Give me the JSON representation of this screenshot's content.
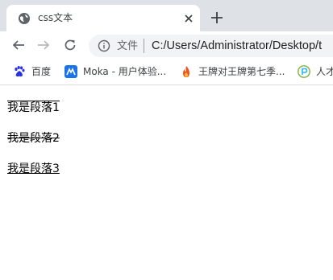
{
  "browser": {
    "tab_title": "css文本",
    "url_scheme_label": "文件",
    "url": "C:/Users/Administrator/Desktop/t"
  },
  "bookmarks": [
    {
      "label": "百度",
      "icon": "baidu-paw-icon"
    },
    {
      "label": "Moka - 用户体验...",
      "icon": "moka-icon"
    },
    {
      "label": "王牌对王牌第七季...",
      "icon": "flame-icon"
    },
    {
      "label": "人才",
      "icon": "green-p-icon"
    }
  ],
  "page": {
    "paragraphs": [
      {
        "text": "我是段落1",
        "decoration": "overline"
      },
      {
        "text": "我是段落2",
        "decoration": "line-through"
      },
      {
        "text": "我是段落3",
        "decoration": "underline"
      }
    ]
  },
  "colors": {
    "tabstrip": "#dee1e6",
    "omnibox": "#f1f3f4",
    "text": "#202124"
  }
}
